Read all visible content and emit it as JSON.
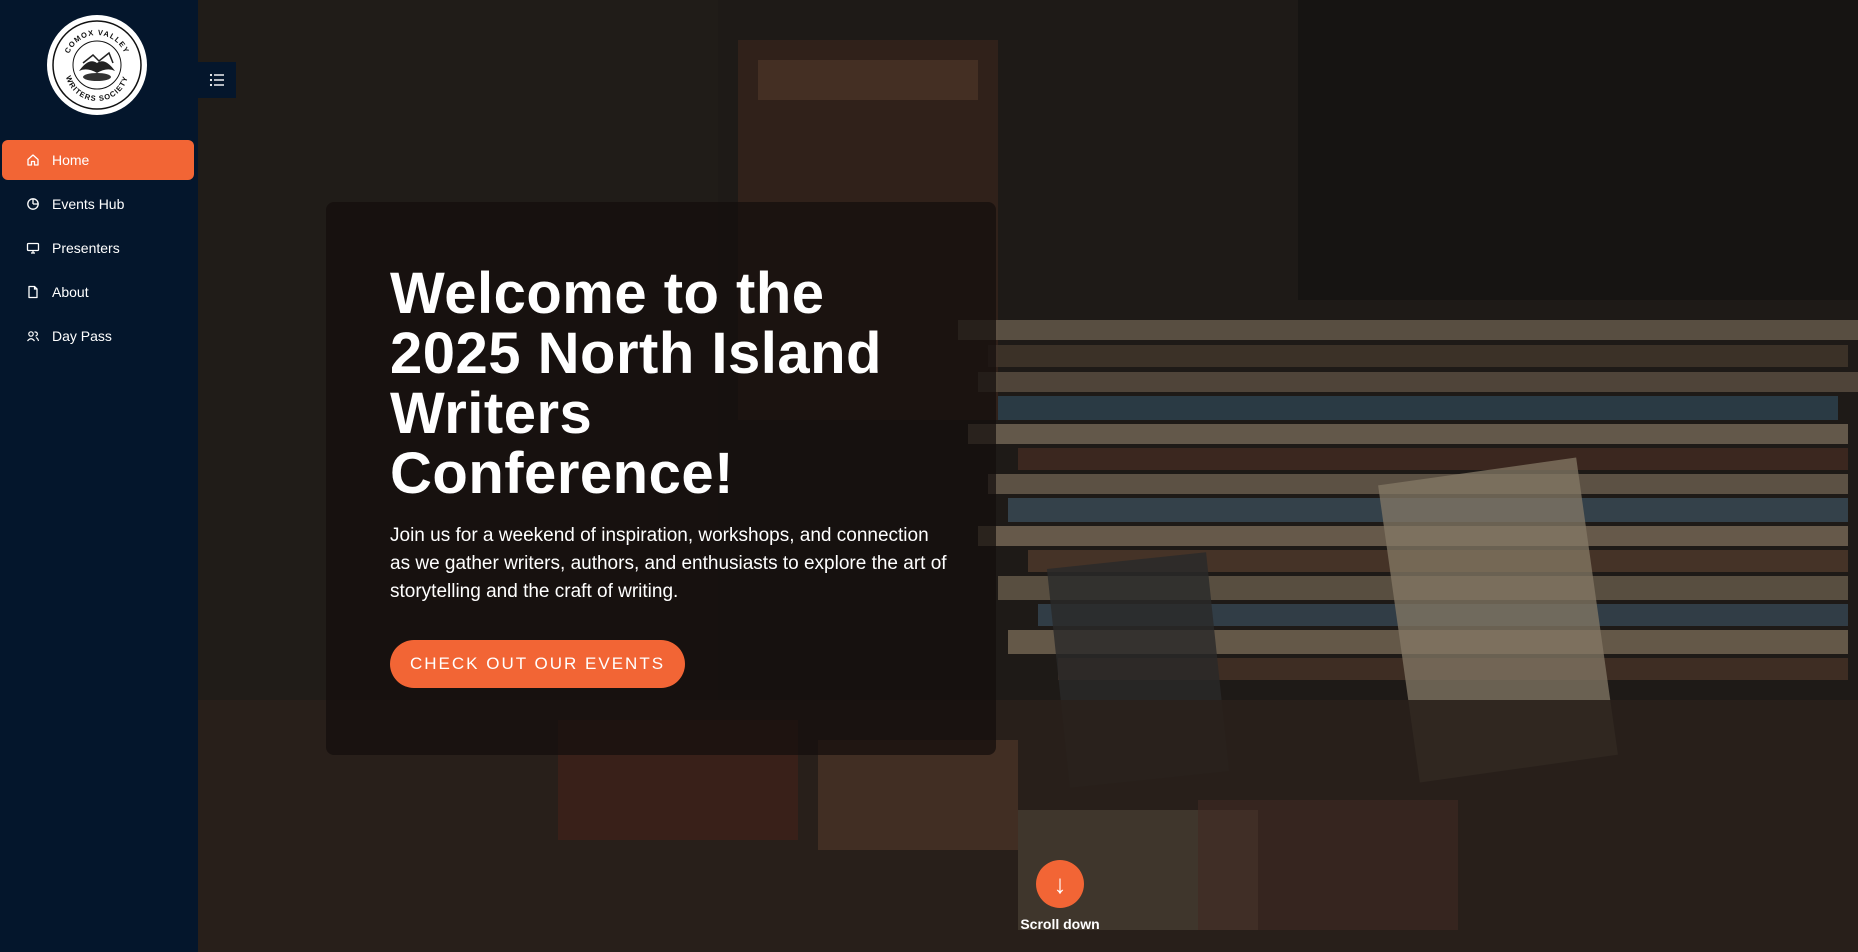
{
  "colors": {
    "sidebar_bg": "#04162c",
    "accent": "#f26535",
    "text": "#ffffff"
  },
  "logo": {
    "name": "comox-valley-writers-society-logo",
    "text_top": "COMOX VALLEY",
    "text_bottom": "WRITERS SOCIETY"
  },
  "sidebar": {
    "items": [
      {
        "label": "Home",
        "icon": "home-icon",
        "active": true
      },
      {
        "label": "Events Hub",
        "icon": "pie-chart-icon",
        "active": false
      },
      {
        "label": "Presenters",
        "icon": "monitor-icon",
        "active": false
      },
      {
        "label": "About",
        "icon": "document-icon",
        "active": false
      },
      {
        "label": "Day Pass",
        "icon": "users-icon",
        "active": false
      }
    ]
  },
  "hero": {
    "title": "Welcome to the 2025 North Island Writers Conference!",
    "text": "Join us for a weekend of inspiration, workshops, and connection as we gather writers, authors, and enthusiasts to explore the art of storytelling and the craft of writing.",
    "cta_label": "CHECK OUT OUR EVENTS"
  },
  "scroll": {
    "label": "Scroll down"
  }
}
